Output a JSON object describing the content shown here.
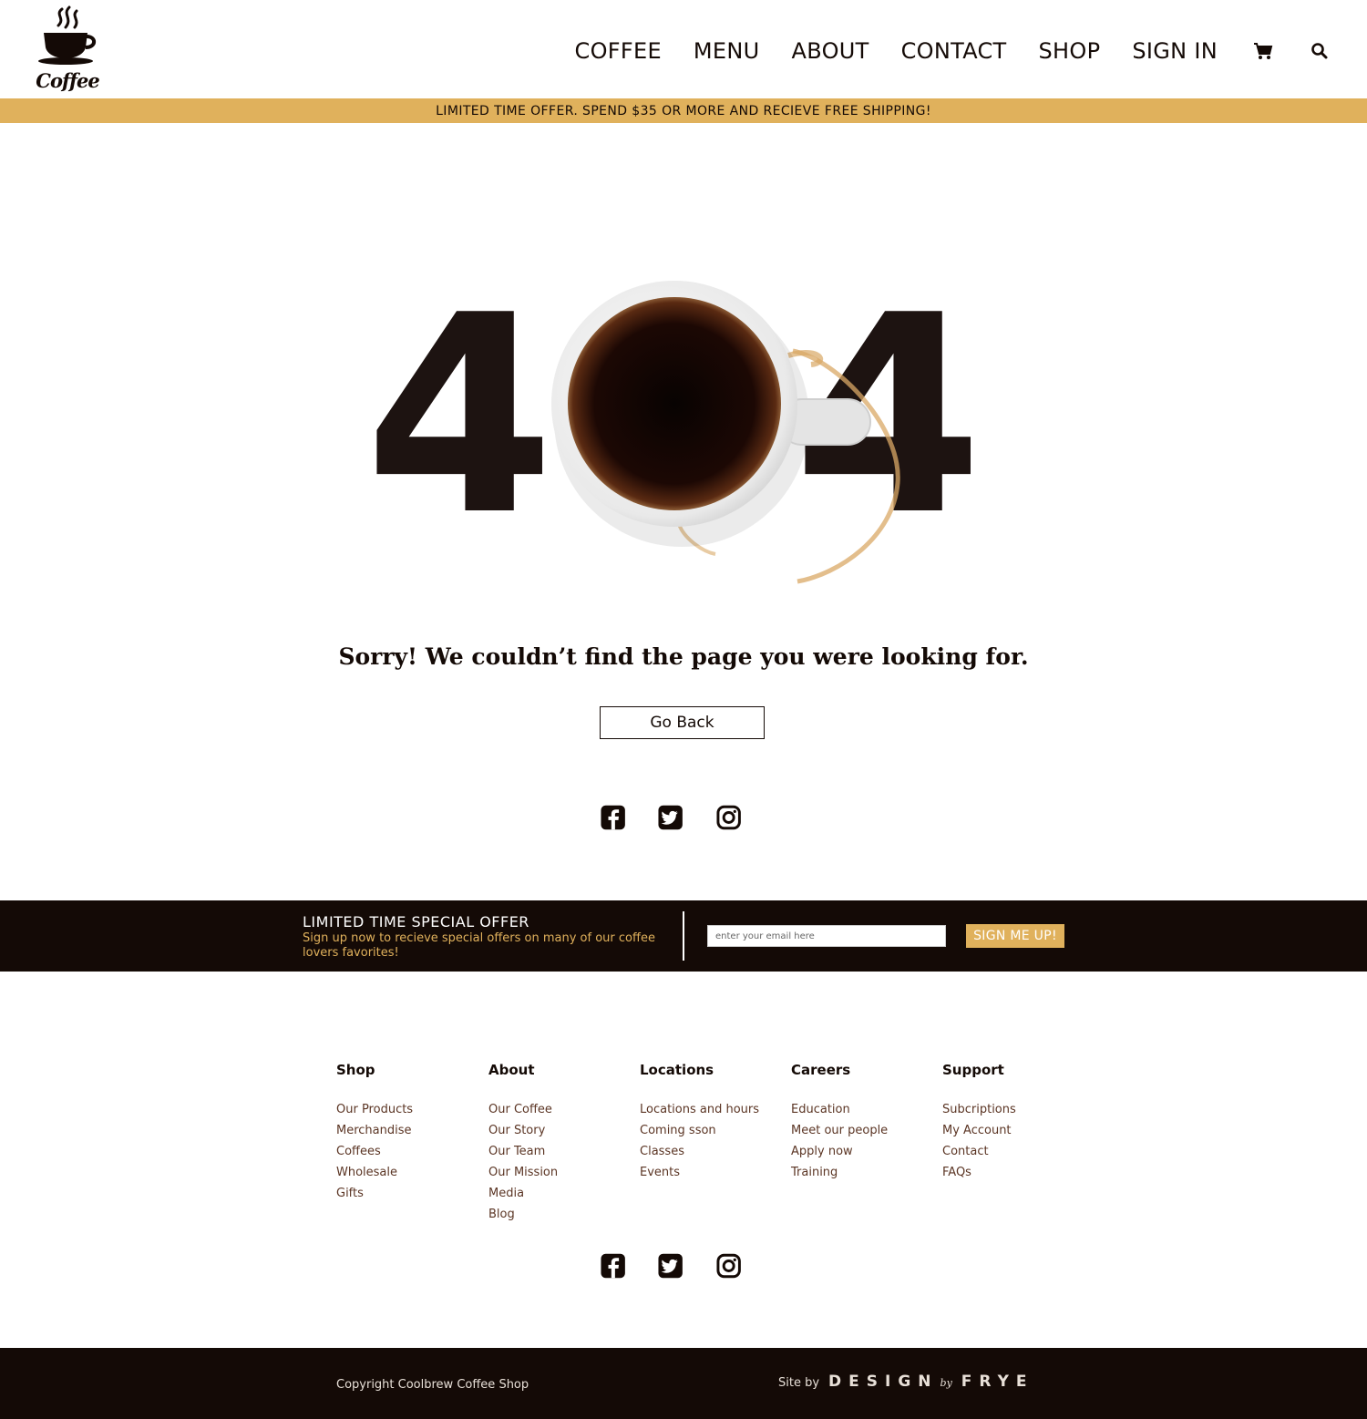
{
  "header": {
    "logo_text": "Coffee",
    "nav": [
      "COFFEE",
      "MENU",
      "ABOUT",
      "CONTACT",
      "SHOP",
      "SIGN IN"
    ],
    "cart_icon": "cart-icon",
    "search_icon": "search-icon"
  },
  "promo": {
    "text": "LIMITED TIME OFFER. SPEND $35 OR MORE AND RECIEVE FREE SHIPPING!"
  },
  "hero": {
    "digit_left": "4",
    "digit_right": "4",
    "center_image": "coffee-cup-top-view"
  },
  "message": {
    "sorry": "Sorry! We couldn’t find the page you were looking for.",
    "go_back": "Go Back"
  },
  "social": [
    "facebook-icon",
    "twitter-icon",
    "instagram-icon"
  ],
  "offer": {
    "title": "LIMITED TIME SPECIAL OFFER",
    "subtitle": "Sign up now to recieve special offers on many of our coffee lovers favorites!",
    "email_placeholder": "enter your email here",
    "signup_label": "SIGN ME UP!"
  },
  "footer": {
    "columns": [
      {
        "title": "Shop",
        "items": [
          "Our Products",
          "Merchandise",
          "Coffees",
          "Wholesale",
          "Gifts"
        ]
      },
      {
        "title": "About",
        "items": [
          "Our Coffee",
          "Our Story",
          "Our Team",
          "Our Mission",
          "Media",
          "Blog"
        ]
      },
      {
        "title": "Locations",
        "items": [
          "Locations and hours",
          "Coming sson",
          "Classes",
          "Events"
        ]
      },
      {
        "title": "Careers",
        "items": [
          "Education",
          "Meet our people",
          "Apply now",
          "Training"
        ]
      },
      {
        "title": "Support",
        "items": [
          "Subcriptions",
          "My Account",
          "Contact",
          "FAQs"
        ]
      }
    ]
  },
  "bottom": {
    "copyright": "Copyright Coolbrew Coffee Shop",
    "site_by": "Site by",
    "brand_left": "DESIGN",
    "brand_mid": "by",
    "brand_right": "FRYE"
  },
  "colors": {
    "gold": "#e0b15c",
    "dark": "#140a06",
    "link_brown": "#5b3524"
  }
}
